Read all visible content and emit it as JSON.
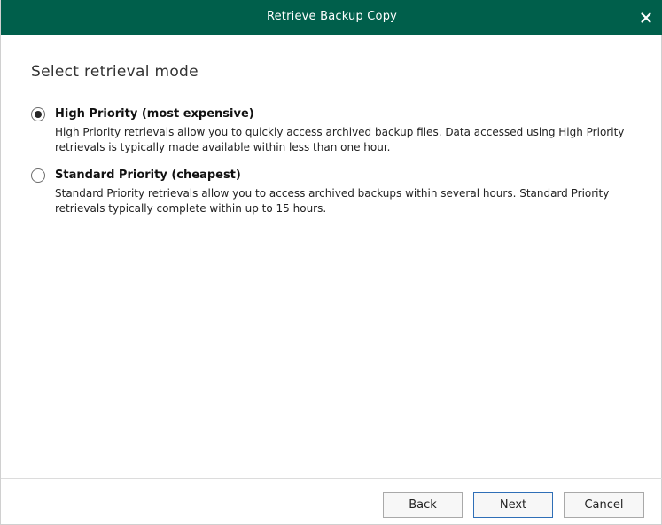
{
  "window": {
    "title": "Retrieve Backup Copy",
    "titlebar_color": "#005f4b",
    "close_icon": "close-icon"
  },
  "main": {
    "heading": "Select retrieval mode",
    "options": [
      {
        "label": "High Priority (most expensive)",
        "description": "High Priority retrievals allow you to quickly access archived backup files. Data accessed using High Priority retrievals is typically made available within less than one hour.",
        "selected": true
      },
      {
        "label": "Standard Priority (cheapest)",
        "description": "Standard Priority retrievals allow you to access archived backups within several hours. Standard Priority retrievals typically complete within up to 15 hours.",
        "selected": false
      }
    ]
  },
  "footer": {
    "back_label": "Back",
    "next_label": "Next",
    "cancel_label": "Cancel"
  }
}
